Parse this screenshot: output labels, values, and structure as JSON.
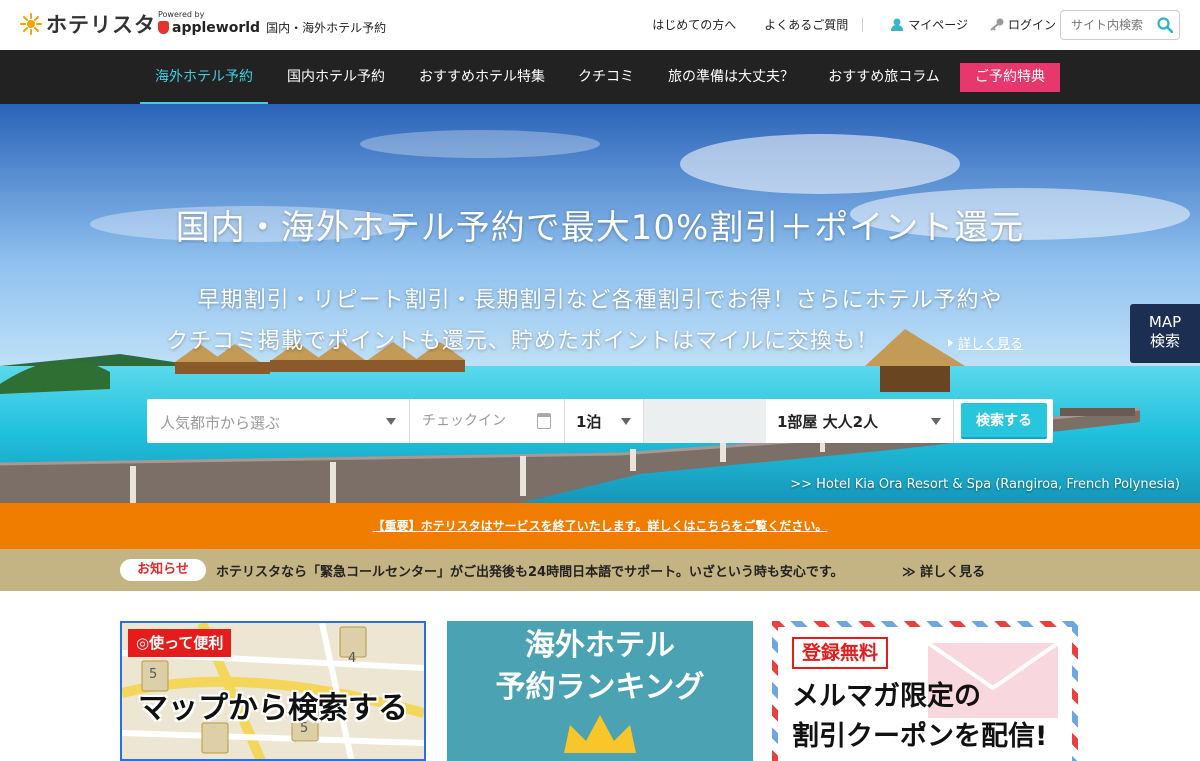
{
  "header": {
    "logo_text": "ホテリスタ",
    "powered_by": "Powered by",
    "partner_name": "appleworld",
    "partner_sub": "国内・海外ホテル予約",
    "links": {
      "first_time": "はじめての方へ",
      "faq": "よくあるご質問",
      "mypage": "マイページ",
      "login": "ログイン"
    },
    "search_placeholder": "サイト内検索"
  },
  "nav": {
    "items": [
      "海外ホテル予約",
      "国内ホテル予約",
      "おすすめホテル特集",
      "クチコミ",
      "旅の準備は大丈夫？",
      "おすすめ旅コラム"
    ],
    "active_index": 0,
    "cta": "ご予約特典"
  },
  "hero": {
    "title": "国内・海外ホテル予約で最大10%割引＋ポイント還元",
    "subtitle_line1": "早期割引・リピート割引・長期割引など各種割引でお得！さらにホテル予約や",
    "subtitle_line2": "クチコミ掲載でポイントも還元、貯めたポイントはマイルに交換も！",
    "more_link": "詳しく見る",
    "map_button_line1": "MAP",
    "map_button_line2": "検索",
    "photo_credit": ">> Hotel Kia Ora Resort & Spa (Rangiroa, French Polynesia)",
    "search": {
      "city_placeholder": "人気都市から選ぶ",
      "checkin_placeholder": "チェックイン",
      "nights": "1泊",
      "rooms": "1部屋 大人2人",
      "button": "検索する"
    }
  },
  "alert": {
    "text": "【重要】ホテリスタはサービスを終了いたします。詳しくはこちらをご覧ください。"
  },
  "notice": {
    "badge": "お知らせ",
    "text": "ホテリスタなら「緊急コールセンター」がご出発後も24時間日本語でサポート。いざという時も安心です。",
    "more": "≫ 詳しく見る"
  },
  "cards": [
    {
      "badge": "◎使って便利",
      "title": "マップから検索する",
      "pins": [
        "5",
        "4",
        "5"
      ]
    },
    {
      "title_line1": "海外ホテル",
      "title_line2": "予約ランキング"
    },
    {
      "badge": "登録無料",
      "title_line1": "メルマガ限定の",
      "title_line2": "割引クーポンを配信!"
    }
  ],
  "colors": {
    "nav_bg": "#222222",
    "nav_active": "#3fd0e0",
    "cta_pink": "#e8376d",
    "search_btn": "#27c6dc",
    "alert_orange": "#f07d00",
    "notice_tan": "#c5b483",
    "map_btn": "#1c2f52"
  },
  "icons": {
    "logo": "sun-icon",
    "partner": "appleworld-logo-icon",
    "mypage": "user-icon",
    "login": "key-icon",
    "search": "search-icon",
    "calendar": "calendar-icon",
    "dropdown": "chevron-down-icon",
    "more": "triangle-right-icon"
  }
}
